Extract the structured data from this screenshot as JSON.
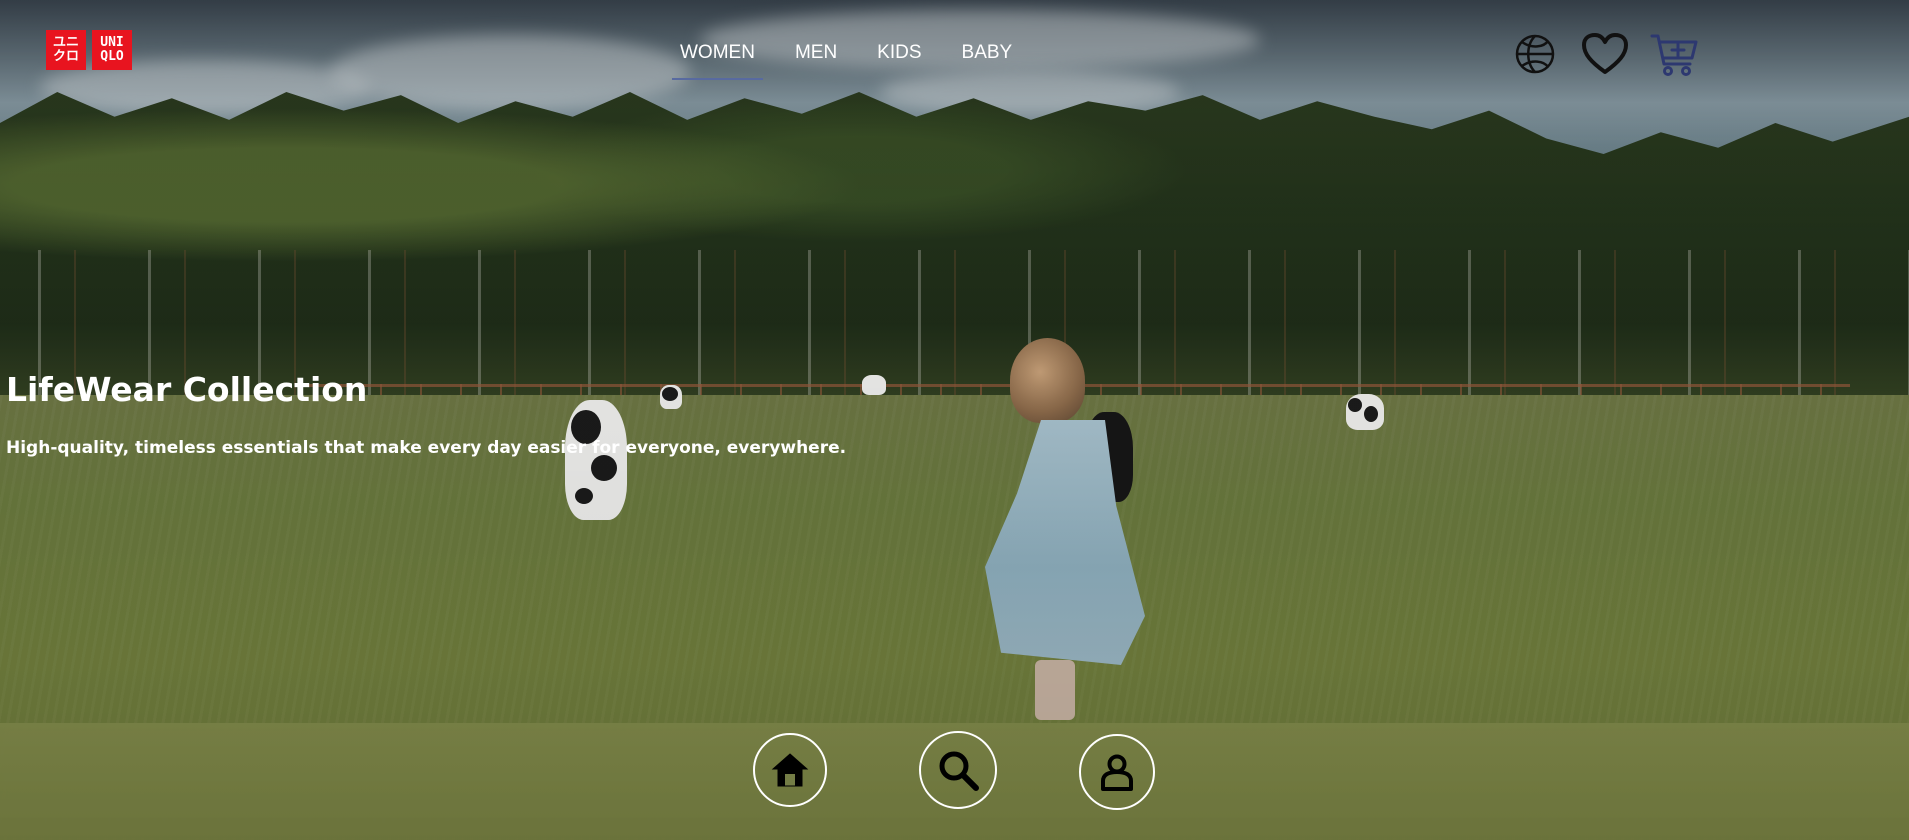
{
  "brand": {
    "logo_left": "ユニ\nクロ",
    "logo_right": "UNI\nQLO",
    "color": "#e8141f"
  },
  "nav": {
    "items": [
      {
        "label": "WOMEN",
        "active": true
      },
      {
        "label": "MEN",
        "active": false
      },
      {
        "label": "KIDS",
        "active": false
      },
      {
        "label": "BABY",
        "active": false
      }
    ],
    "active_underline_color": "#586aa0"
  },
  "header_icons": [
    {
      "name": "globe-icon"
    },
    {
      "name": "heart-icon"
    },
    {
      "name": "cart-add-icon",
      "color": "#2d3870"
    }
  ],
  "hero": {
    "title": "LifeWear Collection",
    "subtitle": "High-quality, timeless essentials that make every day easier for everyone, everywhere."
  },
  "bottom_nav": [
    {
      "name": "home-icon"
    },
    {
      "name": "search-icon"
    },
    {
      "name": "user-icon"
    }
  ]
}
